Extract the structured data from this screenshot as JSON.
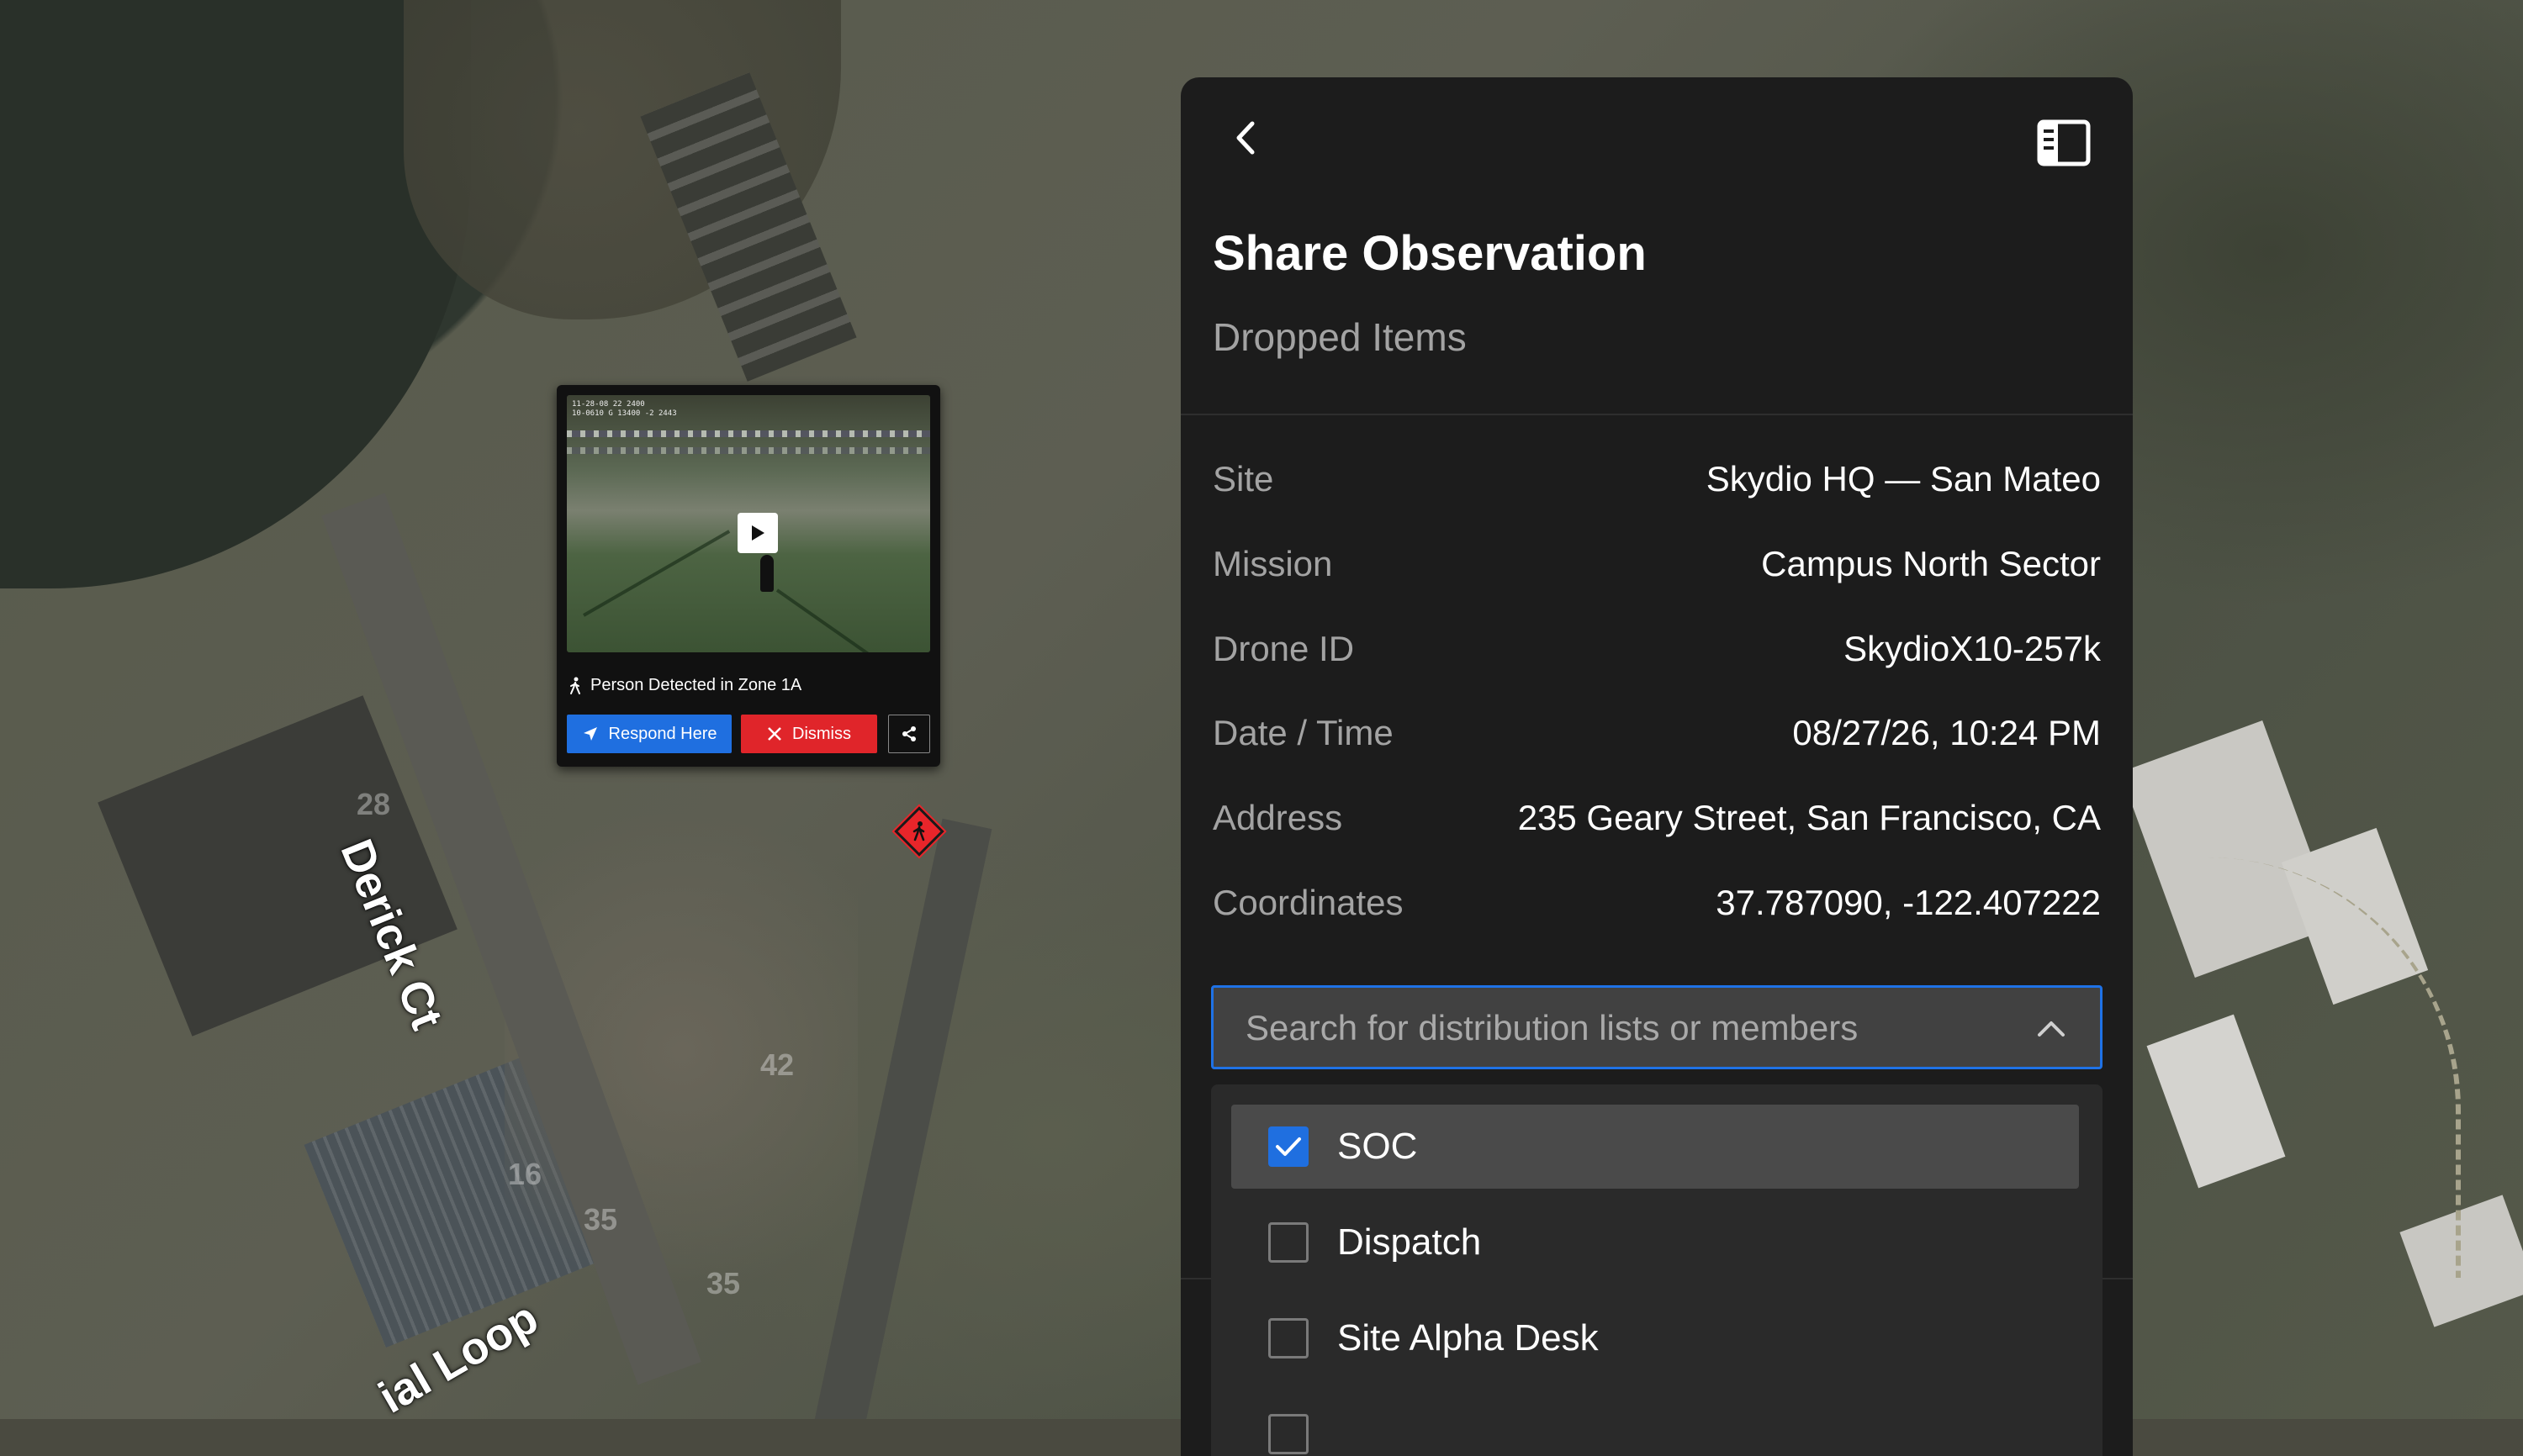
{
  "map": {
    "street_labels": [
      "Derick Ct",
      "ial Loop"
    ],
    "lot_numbers": [
      "28",
      "42",
      "16",
      "35",
      "35"
    ]
  },
  "popup": {
    "timestamp_line1": "11-28-08 22 2400",
    "timestamp_line2": "10-0610 G 13400 -2 2443",
    "caption": "Person Detected in Zone 1A",
    "respond_label": "Respond Here",
    "dismiss_label": "Dismiss",
    "icons": {
      "play": "play-icon",
      "person": "person-walking-icon",
      "respond": "navigation-arrow-icon",
      "dismiss": "close-icon",
      "share": "share-icon"
    }
  },
  "marker": {
    "icon": "person-alert-marker-icon",
    "color": "#e8252a"
  },
  "panel": {
    "title": "Share Observation",
    "subtitle": "Dropped Items",
    "icons": {
      "back": "chevron-left-icon",
      "sidebar": "sidebar-toggle-icon"
    },
    "info": [
      {
        "label": "Site",
        "value": "Skydio HQ — San Mateo"
      },
      {
        "label": "Mission",
        "value": "Campus North Sector"
      },
      {
        "label": "Drone ID",
        "value": "SkydioX10-257k"
      },
      {
        "label": "Date / Time",
        "value": "08/27/26, 10:24 PM"
      },
      {
        "label": "Address",
        "value": "235 Geary Street, San Francisco, CA"
      },
      {
        "label": "Coordinates",
        "value": "37.787090, -122.407222"
      }
    ],
    "search": {
      "placeholder": "Search for distribution lists or members",
      "value": "",
      "icon": "chevron-up-icon"
    },
    "options": [
      {
        "label": "SOC",
        "checked": true
      },
      {
        "label": "Dispatch",
        "checked": false
      },
      {
        "label": "Site Alpha Desk",
        "checked": false
      }
    ]
  },
  "colors": {
    "accent": "#1f6fe0",
    "danger": "#e0252a",
    "panel_bg": "#1c1c1c"
  }
}
